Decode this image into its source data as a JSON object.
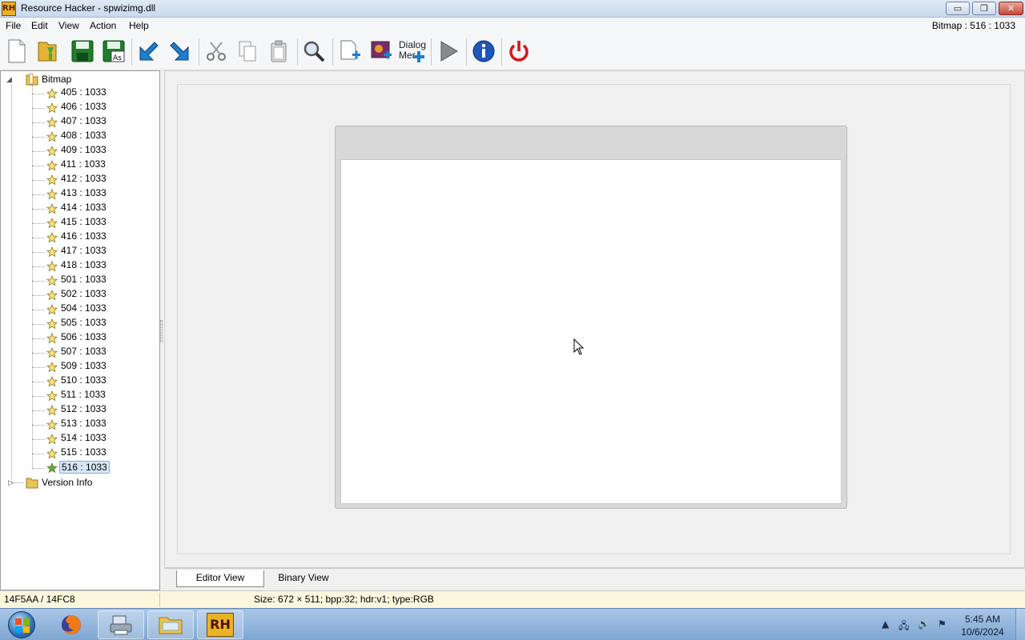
{
  "window": {
    "app_icon_text": "RH",
    "title": "Resource Hacker - spwizimg.dll",
    "minimize": "▭",
    "maximize": "❐",
    "close": "✕"
  },
  "menu": {
    "items": [
      "File",
      "Edit",
      "View",
      "Action",
      "Help"
    ],
    "status_right": "Bitmap : 516 : 1033"
  },
  "toolbar": {
    "dialog_menu_label_line1": "Dialog",
    "dialog_menu_label_line2": "Mer"
  },
  "tree": {
    "root": {
      "label": "Bitmap",
      "expander": "◢",
      "children": [
        "405 : 1033",
        "406 : 1033",
        "407 : 1033",
        "408 : 1033",
        "409 : 1033",
        "411 : 1033",
        "412 : 1033",
        "413 : 1033",
        "414 : 1033",
        "415 : 1033",
        "416 : 1033",
        "417 : 1033",
        "418 : 1033",
        "501 : 1033",
        "502 : 1033",
        "504 : 1033",
        "505 : 1033",
        "506 : 1033",
        "507 : 1033",
        "509 : 1033",
        "510 : 1033",
        "511 : 1033",
        "512 : 1033",
        "513 : 1033",
        "514 : 1033",
        "515 : 1033",
        "516 : 1033"
      ],
      "selected": "516 : 1033"
    },
    "second": {
      "label": "Version Info",
      "expander": "▷"
    }
  },
  "tabs": {
    "editor": "Editor View",
    "binary": "Binary View"
  },
  "status": {
    "offset": "14F5AA / 14FC8",
    "info": "Size: 672 × 511;  bpp:32;  hdr:v1;  type:RGB"
  },
  "taskbar": {
    "rh_label": "RH",
    "time": "5:45 AM",
    "date": "10/6/2024",
    "tray_up": "▲",
    "tray_network": "🖧",
    "tray_volume": "🔊",
    "tray_flag": "⚑"
  }
}
